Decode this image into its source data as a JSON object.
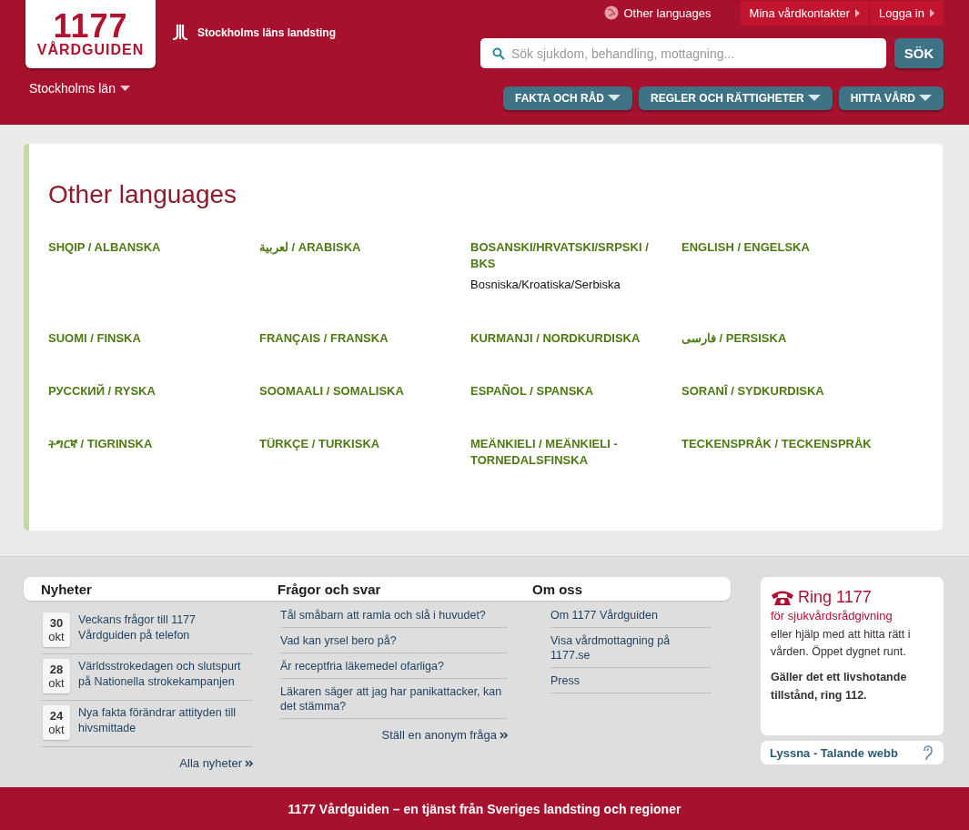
{
  "header": {
    "logo": {
      "number": "1177",
      "name": "VÅRDGUIDEN"
    },
    "partner": "Stockholms läns landsting",
    "region": "Stockholms län",
    "other_languages": "Other languages",
    "top_links": [
      "Mina vårdkontakter",
      "Logga in"
    ],
    "search": {
      "placeholder": "Sök sjukdom, behandling, mottagning...",
      "button": "SÖK"
    },
    "nav": [
      "FAKTA OCH RÅD",
      "REGLER OCH RÄTTIGHETER",
      "HITTA VÅRD"
    ]
  },
  "main": {
    "title": "Other languages",
    "languages": [
      {
        "label": "SHQIP / ALBANSKA"
      },
      {
        "label": "لعربية / ARABISKA"
      },
      {
        "label": "BOSANSKI/HRVATSKI/SRPSKI / BKS",
        "note": "Bosniska/Kroatiska/Serbiska"
      },
      {
        "label": "ENGLISH / ENGELSKA"
      },
      {
        "label": "SUOMI / FINSKA"
      },
      {
        "label": "FRANÇAIS / FRANSKA"
      },
      {
        "label": "KURMANJI / NORDKURDISKA"
      },
      {
        "label": "فارسی / PERSISKA"
      },
      {
        "label": "РУССКИЙ / RYSKA"
      },
      {
        "label": "SOOMAALI / SOMALISKA"
      },
      {
        "label": "ESPAÑOL / SPANSKA"
      },
      {
        "label": "SORANÎ / SYDKURDISKA"
      },
      {
        "label": "ትግርኛ / TIGRINSKA"
      },
      {
        "label": "TÜRKÇE / TURKISKA"
      },
      {
        "label": "MEÄNKIELI / MEÄNKIELI - TORNEDALSFINSKA"
      },
      {
        "label": "TECKENSPRÅK / TECKENSPRÅK"
      }
    ]
  },
  "news": {
    "title": "Nyheter",
    "items": [
      {
        "day": "30",
        "month": "okt",
        "text": "Veckans frågor till 1177 Vårdguiden på telefon"
      },
      {
        "day": "28",
        "month": "okt",
        "text": "Världsstrokedagen och slutspurt på Nationella strokekampanjen"
      },
      {
        "day": "24",
        "month": "okt",
        "text": "Nya fakta förändrar attityden till hivsmittade"
      }
    ],
    "more": "Alla nyheter"
  },
  "faq": {
    "title": "Frågor och svar",
    "items": [
      "Tål småbarn att ramla och slå i huvudet?",
      "Vad kan yrsel bero på?",
      "Är receptfria läkemedel ofarliga?",
      "Läkaren säger att jag har panikattacker, kan det stämma?"
    ],
    "more": "Ställ en anonym fråga"
  },
  "about": {
    "title": "Om oss",
    "items": [
      "Om 1177 Vårdguiden",
      "Visa vårdmottagning på 1177.se",
      "Press"
    ]
  },
  "call": {
    "title": "Ring 1177",
    "subtitle": "för sjukvårdsrådgivning",
    "text": "eller hjälp med att hitta rätt i vården. Öppet dygnet runt.",
    "emergency": "Gäller det ett livshotande tillstånd, ring 112."
  },
  "listen": "Lyssna - Talande webb",
  "footer": "1177 Vårdguiden – en tjänst från Sveriges landsting och regioner"
}
